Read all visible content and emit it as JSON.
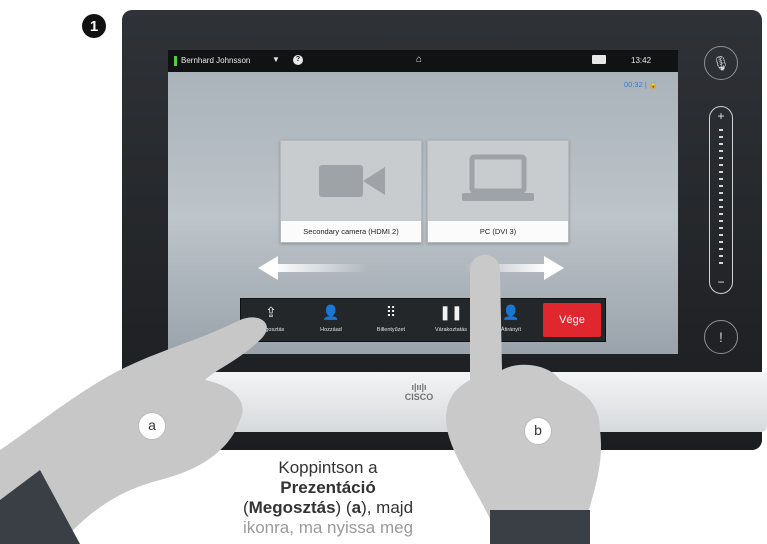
{
  "step": {
    "number": "1"
  },
  "topbar": {
    "user": "Bernhard Johnsson",
    "time": "13:42"
  },
  "call": {
    "timer": "00:32"
  },
  "tiles": [
    {
      "label": "Secondary camera (HDMI 2)"
    },
    {
      "label": "PC (DVI 3)"
    }
  ],
  "callbar": {
    "buttons": [
      {
        "label": "Megosztás",
        "icon": "share-icon"
      },
      {
        "label": "Hozzáad",
        "icon": "add-participant-icon"
      },
      {
        "label": "Billentyűzet",
        "icon": "keypad-icon"
      },
      {
        "label": "Várakoztatás",
        "icon": "hold-icon"
      },
      {
        "label": "Átirányít",
        "icon": "transfer-icon"
      }
    ],
    "end_label": "Vége"
  },
  "device": {
    "brand": "CISCO"
  },
  "markers": {
    "a": "a",
    "b": "b"
  },
  "caption": {
    "prefix": "Koppintson a",
    "bold1": "Prezentáció",
    "paren_open": "(",
    "bold2": "Megosztás",
    "mid": ") (",
    "bold3": "a",
    "suffix": "), majd",
    "faded": "ikonra, ma nyissa meg"
  },
  "colors": {
    "end_button": "#e0262e",
    "presence": "#54d03a",
    "timer": "#2f7fd8"
  }
}
